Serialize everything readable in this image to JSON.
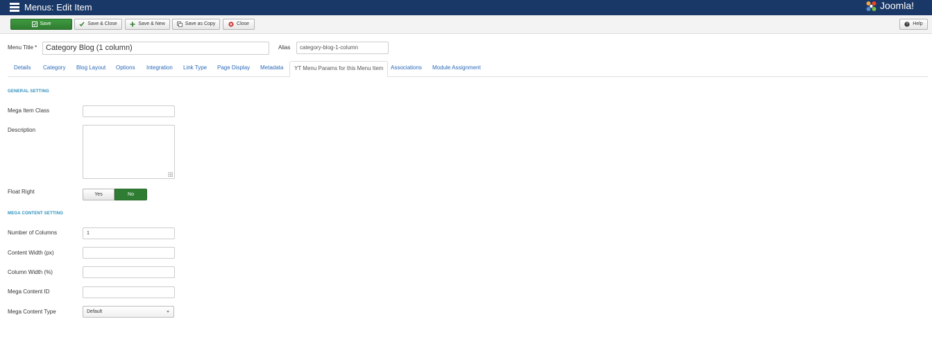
{
  "header": {
    "title": "Menus: Edit Item",
    "brand": "Joomla!",
    "bg_color": "#1a3867"
  },
  "toolbar": {
    "save": "Save",
    "save_close": "Save & Close",
    "save_new": "Save & New",
    "save_copy": "Save as Copy",
    "close": "Close",
    "help": "Help"
  },
  "form": {
    "menu_title_label": "Menu Title *",
    "menu_title_value": "Category Blog (1 column)",
    "alias_label": "Alias",
    "alias_value": "category-blog-1-column"
  },
  "tabs": [
    {
      "label": "Details"
    },
    {
      "label": "Category"
    },
    {
      "label": "Blog Layout"
    },
    {
      "label": "Options"
    },
    {
      "label": "Integration"
    },
    {
      "label": "Link Type"
    },
    {
      "label": "Page Display"
    },
    {
      "label": "Metadata"
    },
    {
      "label": "YT Menu Params for this Menu Item",
      "active": true
    },
    {
      "label": "Associations"
    },
    {
      "label": "Module Assignment"
    }
  ],
  "general": {
    "heading": "GENERAL SETTING",
    "mega_item_class_label": "Mega Item Class",
    "mega_item_class_value": "",
    "description_label": "Description",
    "float_right_label": "Float Right",
    "toggle_yes": "Yes",
    "toggle_no": "No",
    "toggle_selected": "No"
  },
  "mega": {
    "heading": "MEGA CONTENT SETTING",
    "columns_label": "Number of Columns",
    "columns_value": "1",
    "content_width_label": "Content Width (px)",
    "content_width_value": "",
    "column_width_label": "Column Width (%)",
    "column_width_value": "",
    "content_id_label": "Mega Content ID",
    "content_id_value": "",
    "content_type_label": "Mega Content Type",
    "content_type_value": "Default"
  },
  "colors": {
    "accent_green": "#2f7d32",
    "link_blue": "#2a69b8",
    "section_blue": "#2a8fbd"
  }
}
